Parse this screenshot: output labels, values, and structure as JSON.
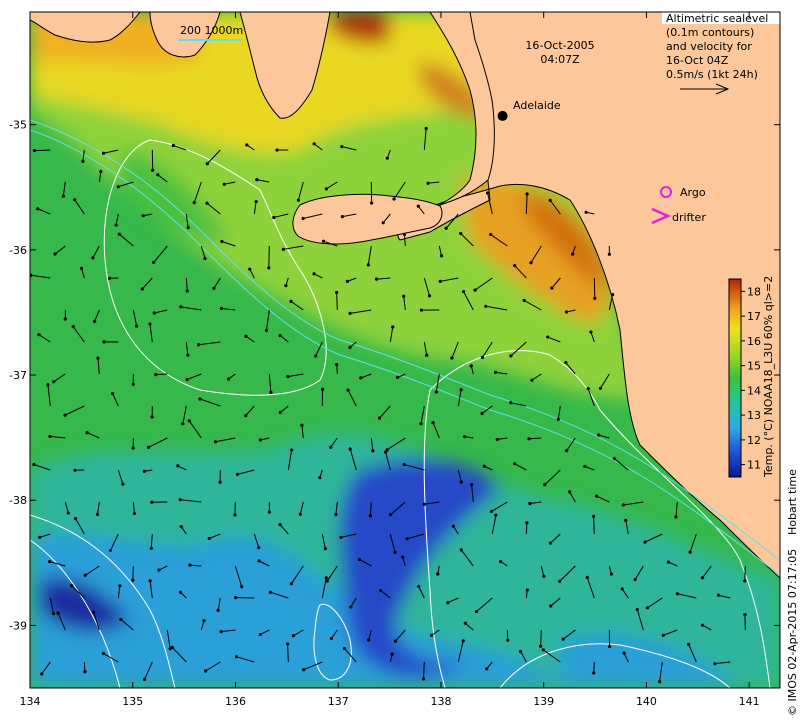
{
  "map": {
    "lon_range": [
      134,
      141.3
    ],
    "lat_range": [
      -39.5,
      -34.1
    ],
    "x_ticks": [
      "134",
      "135",
      "136",
      "137",
      "138",
      "139",
      "140",
      "141"
    ],
    "y_ticks": [
      "-35",
      "-36",
      "-37",
      "-38",
      "-39"
    ],
    "x_tick_values": [
      134,
      135,
      136,
      137,
      138,
      139,
      140,
      141
    ],
    "y_tick_values": [
      -35,
      -36,
      -37,
      -38,
      -39
    ]
  },
  "header": {
    "date": "16-Oct-2005",
    "time": "04:07Z"
  },
  "scale_label": "200  1000m",
  "city": {
    "name": "Adelaide",
    "lon": 138.6,
    "lat": -34.93
  },
  "legend": {
    "lines": [
      "Altimetric sealevel",
      "(0.1m contours)",
      "and velocity for",
      "16-Oct 04Z",
      "0.5m/s (1kt 24h)"
    ],
    "argo_label": "Argo",
    "drifter_label": "drifter",
    "argo_color": "#e020e0"
  },
  "colorbar": {
    "min": 10.5,
    "max": 18.5,
    "ticks": [
      "11",
      "12",
      "13",
      "14",
      "15",
      "16",
      "17",
      "18"
    ],
    "tick_values": [
      11,
      12,
      13,
      14,
      15,
      16,
      17,
      18
    ],
    "label": "Temp. (°C) NOAA18_L3U 60% ql>=2",
    "stops": [
      "#0a1a90",
      "#1f4fd8",
      "#2fa8e8",
      "#20c8a0",
      "#3cc040",
      "#a0d820",
      "#f0e020",
      "#f0a020",
      "#d06010",
      "#b02010"
    ]
  },
  "footer_text": "Hobart time",
  "credit_text": "© IMOS 02-Apr-2015 07:17:05"
}
